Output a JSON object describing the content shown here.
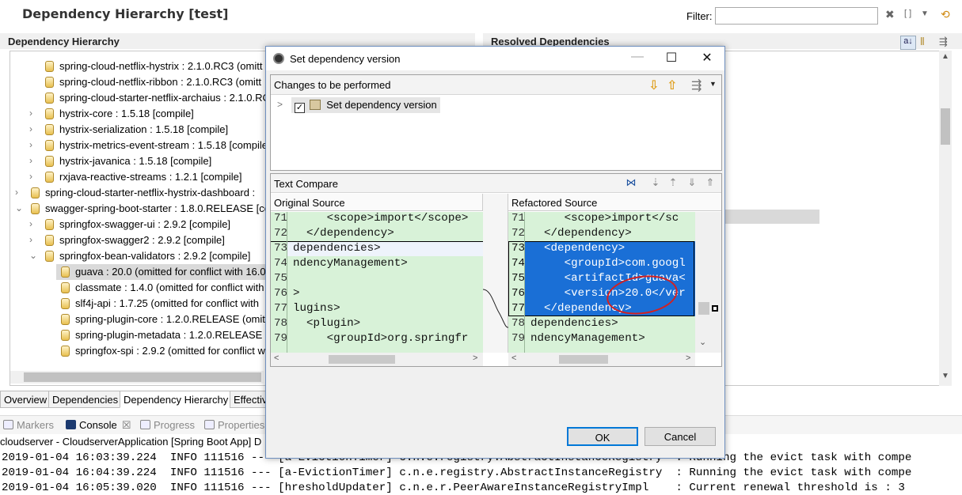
{
  "header": {
    "title": "Dependency Hierarchy [test]",
    "filter_label": "Filter:",
    "filter_value": ""
  },
  "left_section_title": "Dependency Hierarchy",
  "right_section_title": "Resolved Dependencies",
  "tree": [
    {
      "label": "spring-cloud-netflix-hystrix : 2.1.0.RC3 (omitt",
      "indent": 2,
      "expander": ""
    },
    {
      "label": "spring-cloud-netflix-ribbon : 2.1.0.RC3 (omitt",
      "indent": 2,
      "expander": ""
    },
    {
      "label": "spring-cloud-starter-netflix-archaius : 2.1.0.RC",
      "indent": 2,
      "expander": ""
    },
    {
      "label": "hystrix-core : 1.5.18 [compile]",
      "indent": 2,
      "expander": ">"
    },
    {
      "label": "hystrix-serialization : 1.5.18 [compile]",
      "indent": 2,
      "expander": ">"
    },
    {
      "label": "hystrix-metrics-event-stream : 1.5.18 [compile",
      "indent": 2,
      "expander": ">"
    },
    {
      "label": "hystrix-javanica : 1.5.18 [compile]",
      "indent": 2,
      "expander": ">"
    },
    {
      "label": "rxjava-reactive-streams : 1.2.1 [compile]",
      "indent": 2,
      "expander": ">"
    },
    {
      "label": "spring-cloud-starter-netflix-hystrix-dashboard :",
      "indent": 1,
      "expander": ">"
    },
    {
      "label": "swagger-spring-boot-starter : 1.8.0.RELEASE [co",
      "indent": 1,
      "expander": "v"
    },
    {
      "label": "springfox-swagger-ui : 2.9.2 [compile]",
      "indent": 2,
      "expander": ">"
    },
    {
      "label": "springfox-swagger2 : 2.9.2 [compile]",
      "indent": 2,
      "expander": ">"
    },
    {
      "label": "springfox-bean-validators : 2.9.2 [compile]",
      "indent": 2,
      "expander": "v"
    },
    {
      "label": "guava : 20.0 (omitted for conflict with 16.0",
      "indent": 3,
      "expander": ""
    },
    {
      "label": "classmate : 1.4.0 (omitted for conflict with",
      "indent": 3,
      "expander": ""
    },
    {
      "label": "slf4j-api : 1.7.25 (omitted for conflict with",
      "indent": 3,
      "expander": ""
    },
    {
      "label": "spring-plugin-core : 1.2.0.RELEASE (omitte",
      "indent": 3,
      "expander": ""
    },
    {
      "label": "spring-plugin-metadata : 1.2.0.RELEASE (c",
      "indent": 3,
      "expander": ""
    },
    {
      "label": "springfox-spi : 2.9.2 (omitted for conflict w",
      "indent": 3,
      "expander": ""
    }
  ],
  "bottom_tabs": [
    "Overview",
    "Dependencies",
    "Dependency Hierarchy",
    "Effectiv"
  ],
  "console": {
    "tabs": [
      "Markers",
      "Console",
      "Progress",
      "Properties"
    ],
    "title": "cloudserver - CloudserverApplication [Spring Boot App] D",
    "lines": [
      "2019-01-04 16:03:39.224  INFO 111516 --- [a-EvictionTimer] c.n.e.registry.AbstractInstanceRegistry  : Running the evict task with compe",
      "2019-01-04 16:04:39.224  INFO 111516 --- [a-EvictionTimer] c.n.e.registry.AbstractInstanceRegistry  : Running the evict task with compe",
      "2019-01-04 16:05:39.020  INFO 111516 --- [hresholdUpdater] c.n.e.r.PeerAwareInstanceRegistryImpl    : Current renewal threshold is : 3"
    ]
  },
  "dialog": {
    "title": "Set dependency version",
    "changes_title": "Changes to be performed",
    "change_item": "Set dependency version",
    "text_compare_title": "Text Compare",
    "original_title": "Original Source",
    "refactored_title": "Refactored Source",
    "original_lines": [
      {
        "ln": "71",
        "code": "     <scope>import</scope>"
      },
      {
        "ln": "72",
        "code": "  </dependency>"
      },
      {
        "ln": "73",
        "code": "dependencies>"
      },
      {
        "ln": "74",
        "code": "ndencyManagement>"
      },
      {
        "ln": "75",
        "code": ""
      },
      {
        "ln": "76",
        "code": ">"
      },
      {
        "ln": "77",
        "code": "lugins>"
      },
      {
        "ln": "78",
        "code": "  <plugin>"
      },
      {
        "ln": "79",
        "code": "     <groupId>org.springfr"
      }
    ],
    "refactored_lines": [
      {
        "ln": "71",
        "code": "     <scope>import</sc"
      },
      {
        "ln": "72",
        "code": "  </dependency>"
      },
      {
        "ln": "73",
        "code": "  <dependency>"
      },
      {
        "ln": "74",
        "code": "     <groupId>com.googl"
      },
      {
        "ln": "75",
        "code": "     <artifactId>guava<"
      },
      {
        "ln": "76",
        "code": "     <version>20.0</ver"
      },
      {
        "ln": "77",
        "code": "  </dependency>"
      },
      {
        "ln": "78",
        "code": "dependencies>"
      },
      {
        "ln": "79",
        "code": "ndencyManagement>"
      }
    ],
    "ok_label": "OK",
    "cancel_label": "Cancel"
  }
}
